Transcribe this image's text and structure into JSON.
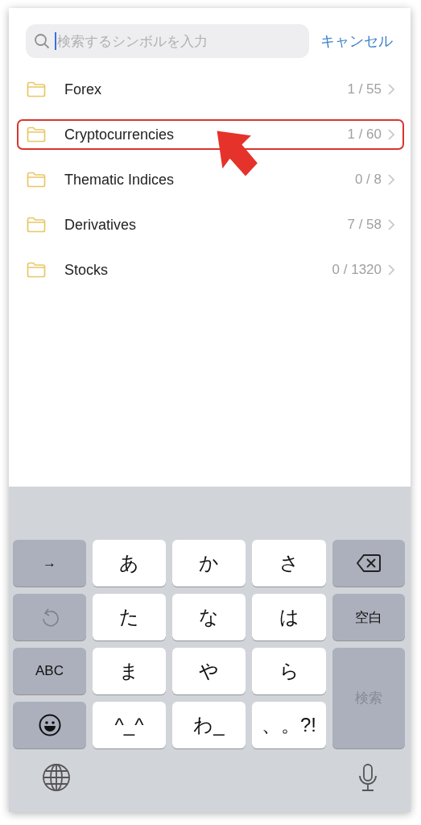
{
  "search": {
    "placeholder": "検索するシンボルを入力",
    "focused": true,
    "cancel": "キャンセル"
  },
  "categories": [
    {
      "name": "Forex",
      "count": "1 / 55",
      "highlighted": false
    },
    {
      "name": "Cryptocurrencies",
      "count": "1 / 60",
      "highlighted": true
    },
    {
      "name": "Thematic Indices",
      "count": "0 / 8",
      "highlighted": false
    },
    {
      "name": "Derivatives",
      "count": "7 / 58",
      "highlighted": false
    },
    {
      "name": "Stocks",
      "count": "0 / 1320",
      "highlighted": false
    }
  ],
  "keyboard": {
    "keys": [
      {
        "kind": "function",
        "label": "→"
      },
      {
        "kind": "char",
        "label": "あ"
      },
      {
        "kind": "char",
        "label": "か"
      },
      {
        "kind": "char",
        "label": "さ"
      },
      {
        "kind": "backspace"
      },
      {
        "kind": "undo"
      },
      {
        "kind": "char",
        "label": "た"
      },
      {
        "kind": "char",
        "label": "な"
      },
      {
        "kind": "char",
        "label": "は"
      },
      {
        "kind": "function",
        "label": "空白"
      },
      {
        "kind": "function",
        "label": "ABC"
      },
      {
        "kind": "char",
        "label": "ま"
      },
      {
        "kind": "char",
        "label": "や"
      },
      {
        "kind": "char",
        "label": "ら"
      },
      {
        "kind": "action",
        "label": "検索",
        "disabled": true
      },
      {
        "kind": "emoji"
      },
      {
        "kind": "char",
        "label": "^_^"
      },
      {
        "kind": "char",
        "label": "わ_"
      },
      {
        "kind": "char",
        "label": "、。?!"
      }
    ]
  }
}
